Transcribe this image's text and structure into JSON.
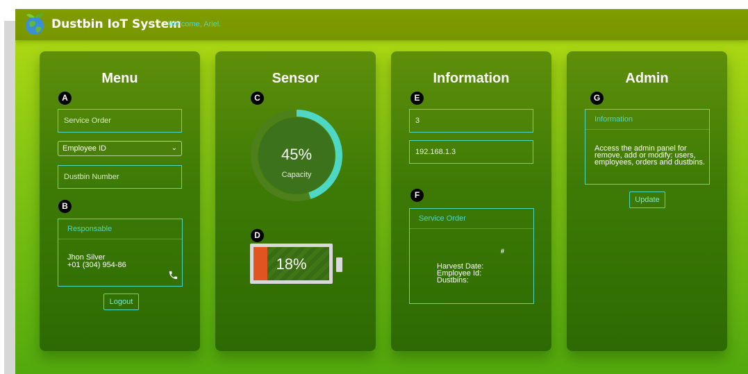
{
  "header": {
    "title": "Dustbin IoT System",
    "welcome": "Welcome, Ariel."
  },
  "colors": {
    "accent": "#4fd7c5",
    "battery_fill": "#e2541f",
    "topbar": "#7f9c00"
  },
  "menu": {
    "title": "Menu",
    "badge_a": "A",
    "service_order_placeholder": "Service Order",
    "employee_select_value": "Employee ID",
    "dustbin_placeholder": "Dustbin Number",
    "badge_b": "B",
    "responsable": {
      "header": "Responsable",
      "name": "Jhon Silver",
      "phone": "+01 (304) 954-86",
      "icon": "phone-icon"
    },
    "logout_label": "Logout"
  },
  "sensor": {
    "title": "Sensor",
    "badge_c": "C",
    "capacity_value": "45%",
    "capacity_label": "Capacity",
    "capacity_fraction": 0.45,
    "badge_d": "D",
    "battery_value": "18%",
    "battery_fraction": 0.18
  },
  "information": {
    "title": "Information",
    "badge_e": "E",
    "field1_value": "3",
    "field2_value": "192.168.1.3",
    "badge_f": "F",
    "service_order": {
      "header": "Service Order",
      "hash": "#",
      "harvest_date": "Harvest Date:",
      "employee_id": "Employee Id:",
      "dustbins": "Dustbins:"
    }
  },
  "admin": {
    "title": "Admin",
    "badge_g": "G",
    "info": {
      "header": "Information",
      "line1": "Access the admin panel for",
      "line2": "remove, add or modify: users,",
      "line3": "employees, orders and dustbins."
    },
    "update_label": "Update"
  }
}
